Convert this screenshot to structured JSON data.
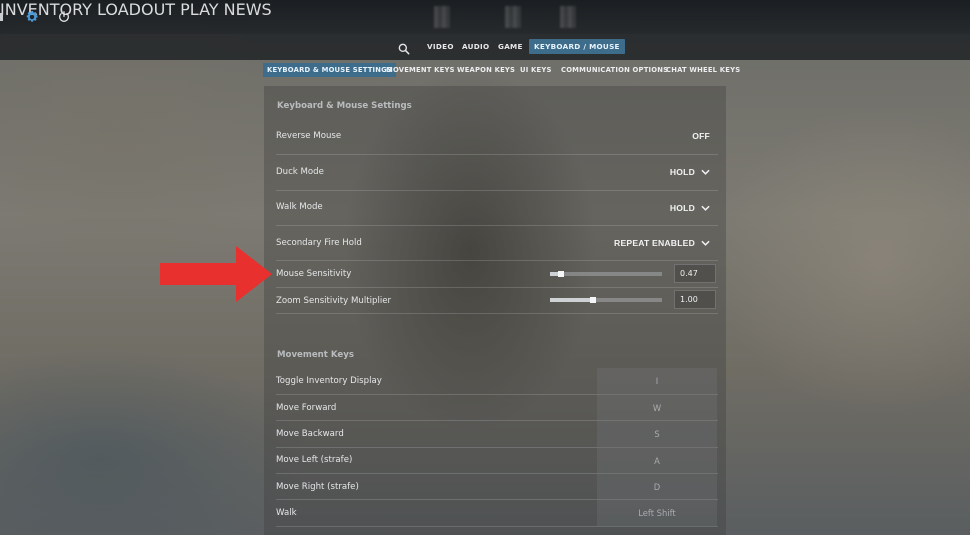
{
  "topbar": {
    "nav": [
      "INVENTORY",
      "LOADOUT",
      "PLAY",
      "NEWS"
    ]
  },
  "icons": {
    "settings": "gear-icon",
    "power": "power-icon",
    "search": "search-icon",
    "chevron": "chevron-down-icon"
  },
  "subnav": {
    "tabs": [
      "VIDEO",
      "AUDIO",
      "GAME",
      "KEYBOARD / MOUSE"
    ],
    "active": "KEYBOARD / MOUSE"
  },
  "categories": {
    "tabs": [
      "KEYBOARD & MOUSE SETTINGS",
      "MOVEMENT KEYS",
      "WEAPON KEYS",
      "UI KEYS",
      "COMMUNICATION OPTIONS",
      "CHAT WHEEL KEYS"
    ],
    "active": "KEYBOARD & MOUSE SETTINGS"
  },
  "kms": {
    "title": "Keyboard & Mouse Settings",
    "rows": [
      {
        "label": "Reverse Mouse",
        "value": "OFF"
      },
      {
        "label": "Duck Mode",
        "value": "HOLD"
      },
      {
        "label": "Walk Mode",
        "value": "HOLD"
      },
      {
        "label": "Secondary Fire Hold",
        "value": "REPEAT ENABLED"
      }
    ],
    "sliders": [
      {
        "label": "Mouse Sensitivity",
        "value": "0.47",
        "fraction": 0.1
      },
      {
        "label": "Zoom Sensitivity Multiplier",
        "value": "1.00",
        "fraction": 0.38
      }
    ]
  },
  "movement": {
    "title": "Movement Keys",
    "rows": [
      {
        "label": "Toggle Inventory Display",
        "key": "I"
      },
      {
        "label": "Move Forward",
        "key": "W"
      },
      {
        "label": "Move Backward",
        "key": "S"
      },
      {
        "label": "Move Left (strafe)",
        "key": "A"
      },
      {
        "label": "Move Right (strafe)",
        "key": "D"
      },
      {
        "label": "Walk",
        "key": "Left Shift"
      }
    ]
  },
  "colors": {
    "accent": "#3e6d8c",
    "arrow": "#e8302e"
  }
}
